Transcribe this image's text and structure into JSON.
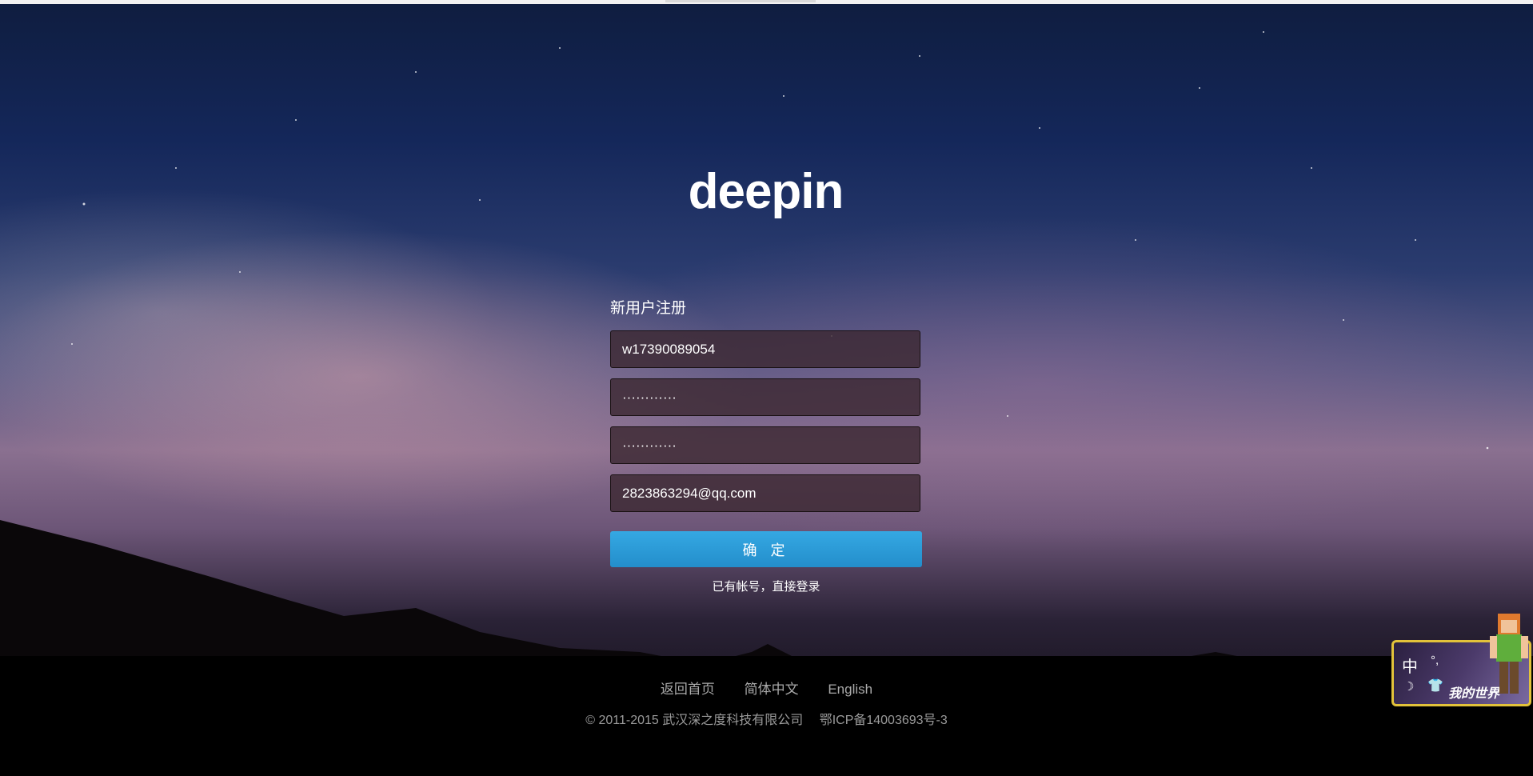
{
  "logo": {
    "text": "deepin"
  },
  "form": {
    "title": "新用户注册",
    "username": {
      "value": "w17390089054"
    },
    "password": {
      "value": "············"
    },
    "confirm_password": {
      "value": "············"
    },
    "email": {
      "value": "2823863294@qq.com"
    },
    "submit_label": "确 定",
    "login_link": "已有帐号，直接登录"
  },
  "footer": {
    "links": [
      "返回首页",
      "简体中文",
      "English"
    ],
    "copyright": "© 2011-2015 武汉深之度科技有限公司",
    "icp": "鄂ICP备14003693号-3"
  },
  "widget": {
    "ime_label": "中",
    "ime_punct": "°,",
    "brand_text": "我的世界",
    "icons": [
      "moon-icon",
      "shirt-icon"
    ],
    "border_color": "#e2c23a"
  },
  "colors": {
    "button": "#2a9ad6",
    "input_bg": "#3c2832"
  }
}
